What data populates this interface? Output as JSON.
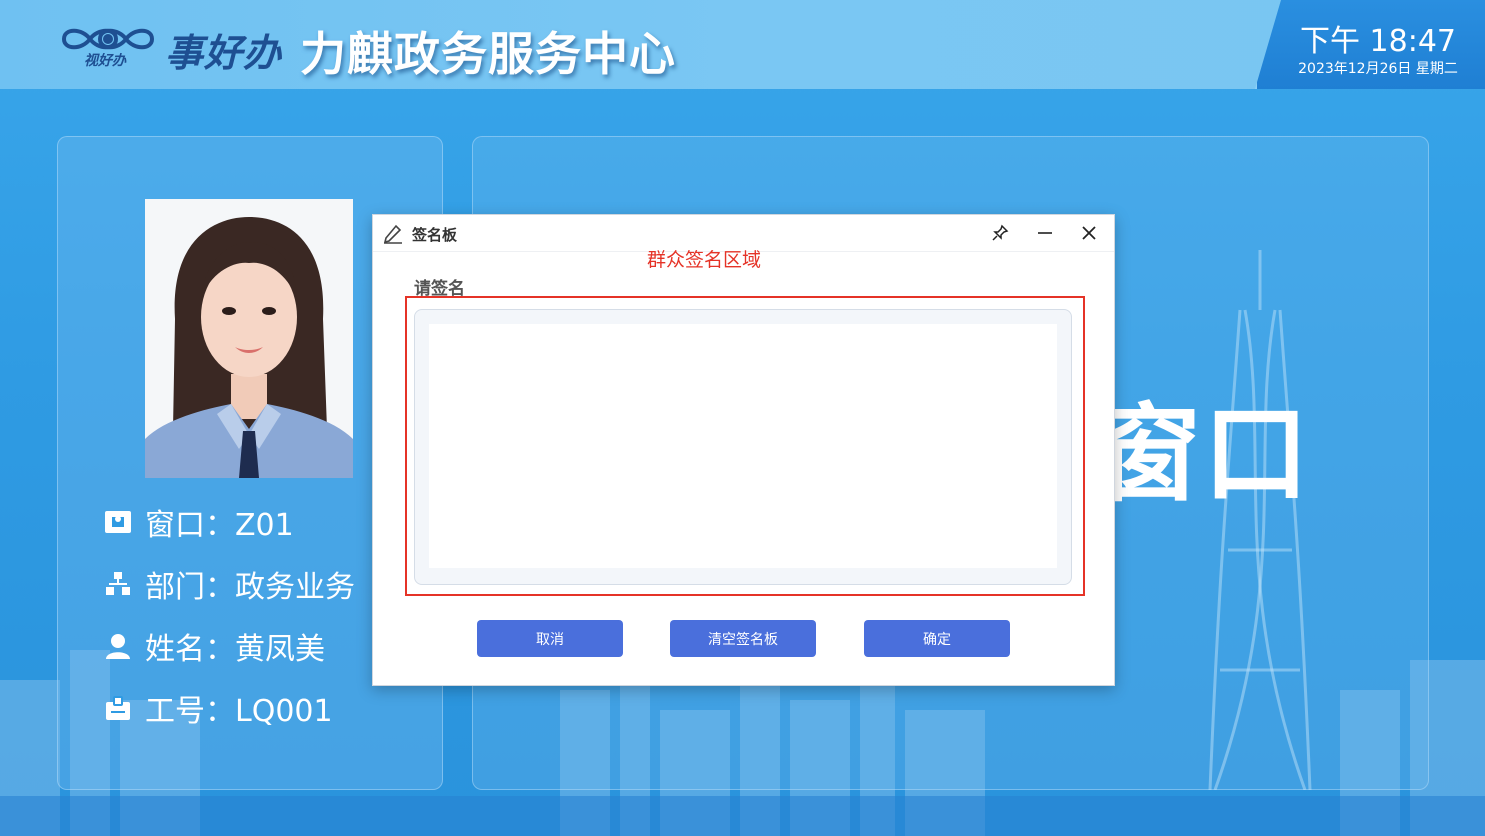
{
  "header": {
    "logo_sub": "视好办",
    "logo_name": "事好办",
    "title": "力麒政务服务中心",
    "time": "下午 18:47",
    "date": "2023年12月26日 星期二"
  },
  "staff": {
    "window": "窗口：Z01",
    "department": "部门：政务业务",
    "name": "姓名：黄凤美",
    "employee_id": "工号：LQ001"
  },
  "background_text": "窗口",
  "dialog": {
    "title": "签名板",
    "annotation": "群众签名区域",
    "sign_label": "请签名",
    "buttons": {
      "cancel": "取消",
      "clear": "清空签名板",
      "confirm": "确定"
    },
    "titlebar_icons": [
      "pin-icon",
      "minimize-icon",
      "close-icon"
    ]
  },
  "colors": {
    "primary_button": "#4a6fdc",
    "annotation_red": "#e53327",
    "header_bg": "#7ac7f3"
  }
}
